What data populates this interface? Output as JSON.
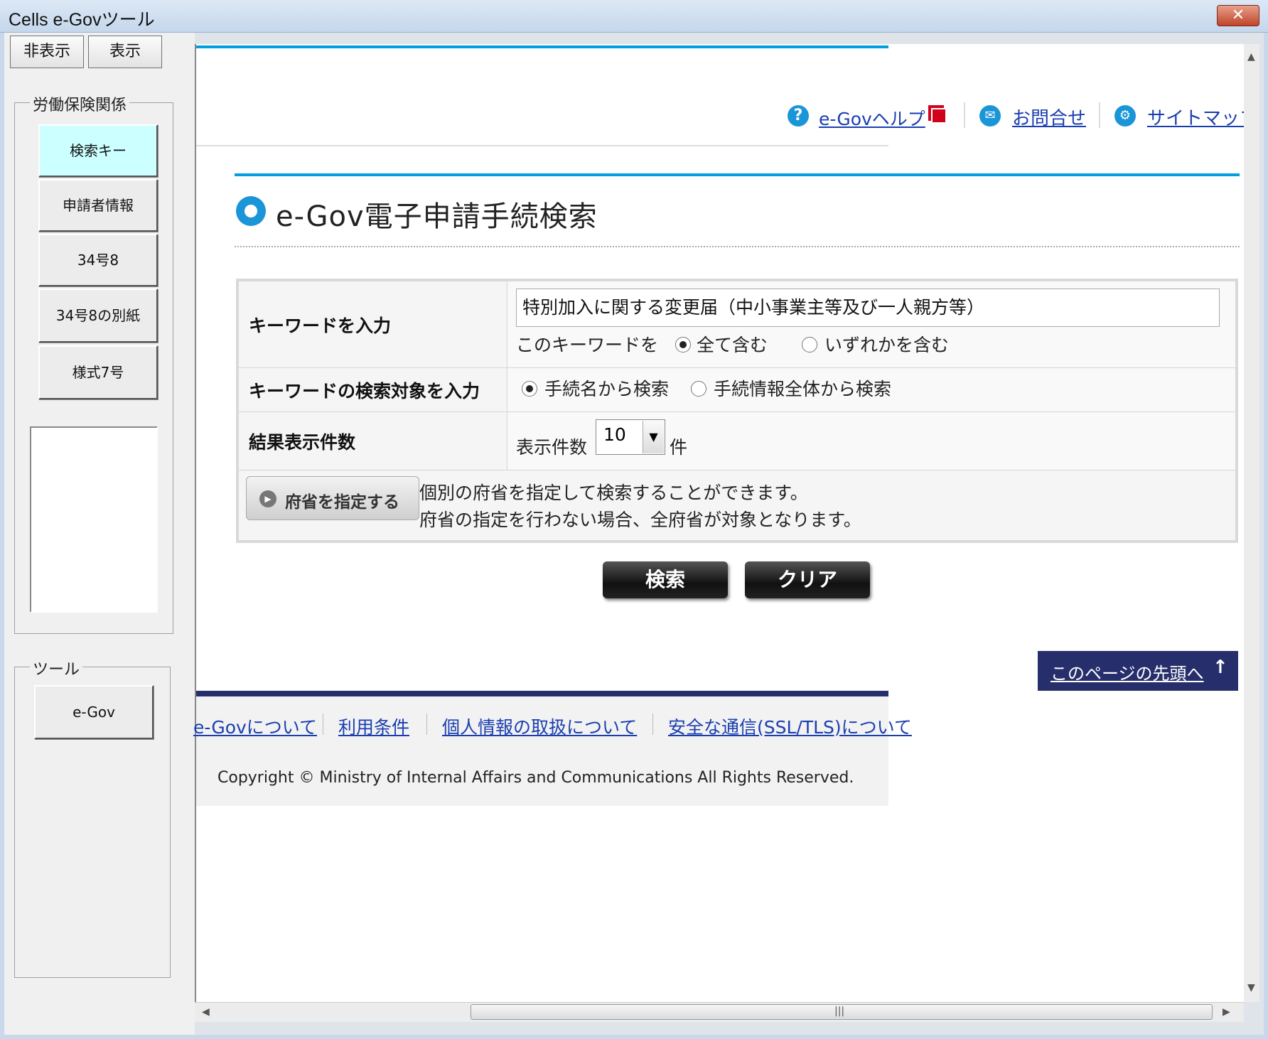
{
  "window": {
    "title": "Cells e-Govツール",
    "close_glyph": "✕"
  },
  "left_panel": {
    "hide_button": "非表示",
    "show_button": "表示",
    "group1_label": "労働保険関係",
    "group1_buttons": [
      "検索キー",
      "申請者情報",
      "34号8",
      "34号8の別紙",
      "様式7号"
    ],
    "group2_label": "ツール",
    "group2_buttons": [
      "e-Gov"
    ]
  },
  "header": {
    "links": [
      "e-Govヘルプ",
      "お問合せ",
      "サイトマップ"
    ],
    "help_icon": "?",
    "contact_icon": "✉",
    "sitemap_icon": "⚙"
  },
  "main": {
    "title": "e-Gov電子申請手続検索",
    "title_icon": "●"
  },
  "form": {
    "keyword_label": "キーワードを入力",
    "keyword_value": "特別加入に関する変更届（中小事業主等及び一人親方等）",
    "keyword_mode_label": "このキーワードを",
    "keyword_mode_options": [
      "全て含む",
      "いずれかを含む"
    ],
    "keyword_mode_selected": "全て含む",
    "target_label": "キーワードの検索対象を入力",
    "target_options": [
      "手続名から検索",
      "手続情報全体から検索"
    ],
    "target_selected": "手続名から検索",
    "count_label": "結果表示件数",
    "count_prefix": "表示件数",
    "count_value": "10",
    "count_suffix": "件",
    "ministry_button": "府省を指定する",
    "ministry_note_1": "個別の府省を指定して検索することができます。",
    "ministry_note_2": "府省の指定を行わない場合、全府省が対象となります。"
  },
  "buttons": {
    "search": "検索",
    "clear": "クリア"
  },
  "back_to_top": "このページの先頭へ",
  "back_to_top_arrow": "↑",
  "footer": {
    "links": [
      "e-Govについて",
      "利用条件",
      "個人情報の取扱について",
      "安全な通信(SSL/TLS)について"
    ],
    "copyright": "Copyright © Ministry of Internal Affairs and Communications All Rights Reserved."
  },
  "scrollbar": {
    "grip": "|||"
  }
}
